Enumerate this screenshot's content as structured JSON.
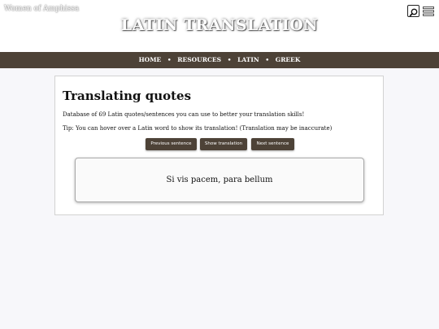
{
  "header": {
    "site_name": "Women of Amphissa",
    "title": "LATIN TRANSLATION",
    "search_icon": "search-icon",
    "menu_icon": "hamburger-menu-icon"
  },
  "nav": {
    "items": [
      "HOME",
      "RESOURCES",
      "LATIN",
      "GREEK"
    ],
    "separator": "•"
  },
  "main": {
    "heading": "Translating quotes",
    "description": "Database of 69 Latin quotes/sentences you can use to better your translation skills!",
    "tip": "Tip: You can hover over a Latin word to show its translation! (Translation may be inaccurate)",
    "buttons": {
      "previous": "Previous sentence",
      "show": "Show translation",
      "next": "Next sentence"
    },
    "quote": "Si vis pacem, para bellum"
  },
  "colors": {
    "accent": "#4d4237",
    "background": "#f7f7fa"
  }
}
